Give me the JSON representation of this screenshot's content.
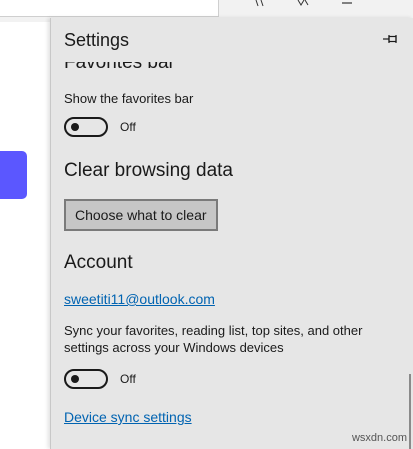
{
  "panel": {
    "title": "Settings",
    "pin_icon": "pin-icon"
  },
  "favorites_bar": {
    "heading": "Favorites bar",
    "show_label": "Show the favorites bar",
    "toggle_state": "Off"
  },
  "clear_browsing": {
    "heading": "Clear browsing data",
    "button_label": "Choose what to clear"
  },
  "account": {
    "heading": "Account",
    "email": "sweetiti11@outlook.com",
    "sync_description": "Sync your favorites, reading list, top sites, and other settings across your Windows devices",
    "toggle_state": "Off",
    "device_sync_link": "Device sync settings"
  },
  "watermark": "wsxdn.com",
  "colors": {
    "panel_bg": "#e6e6e6",
    "link": "#0063b1",
    "accent_block": "#5b57ff",
    "button_bg": "#c6c6c6"
  }
}
